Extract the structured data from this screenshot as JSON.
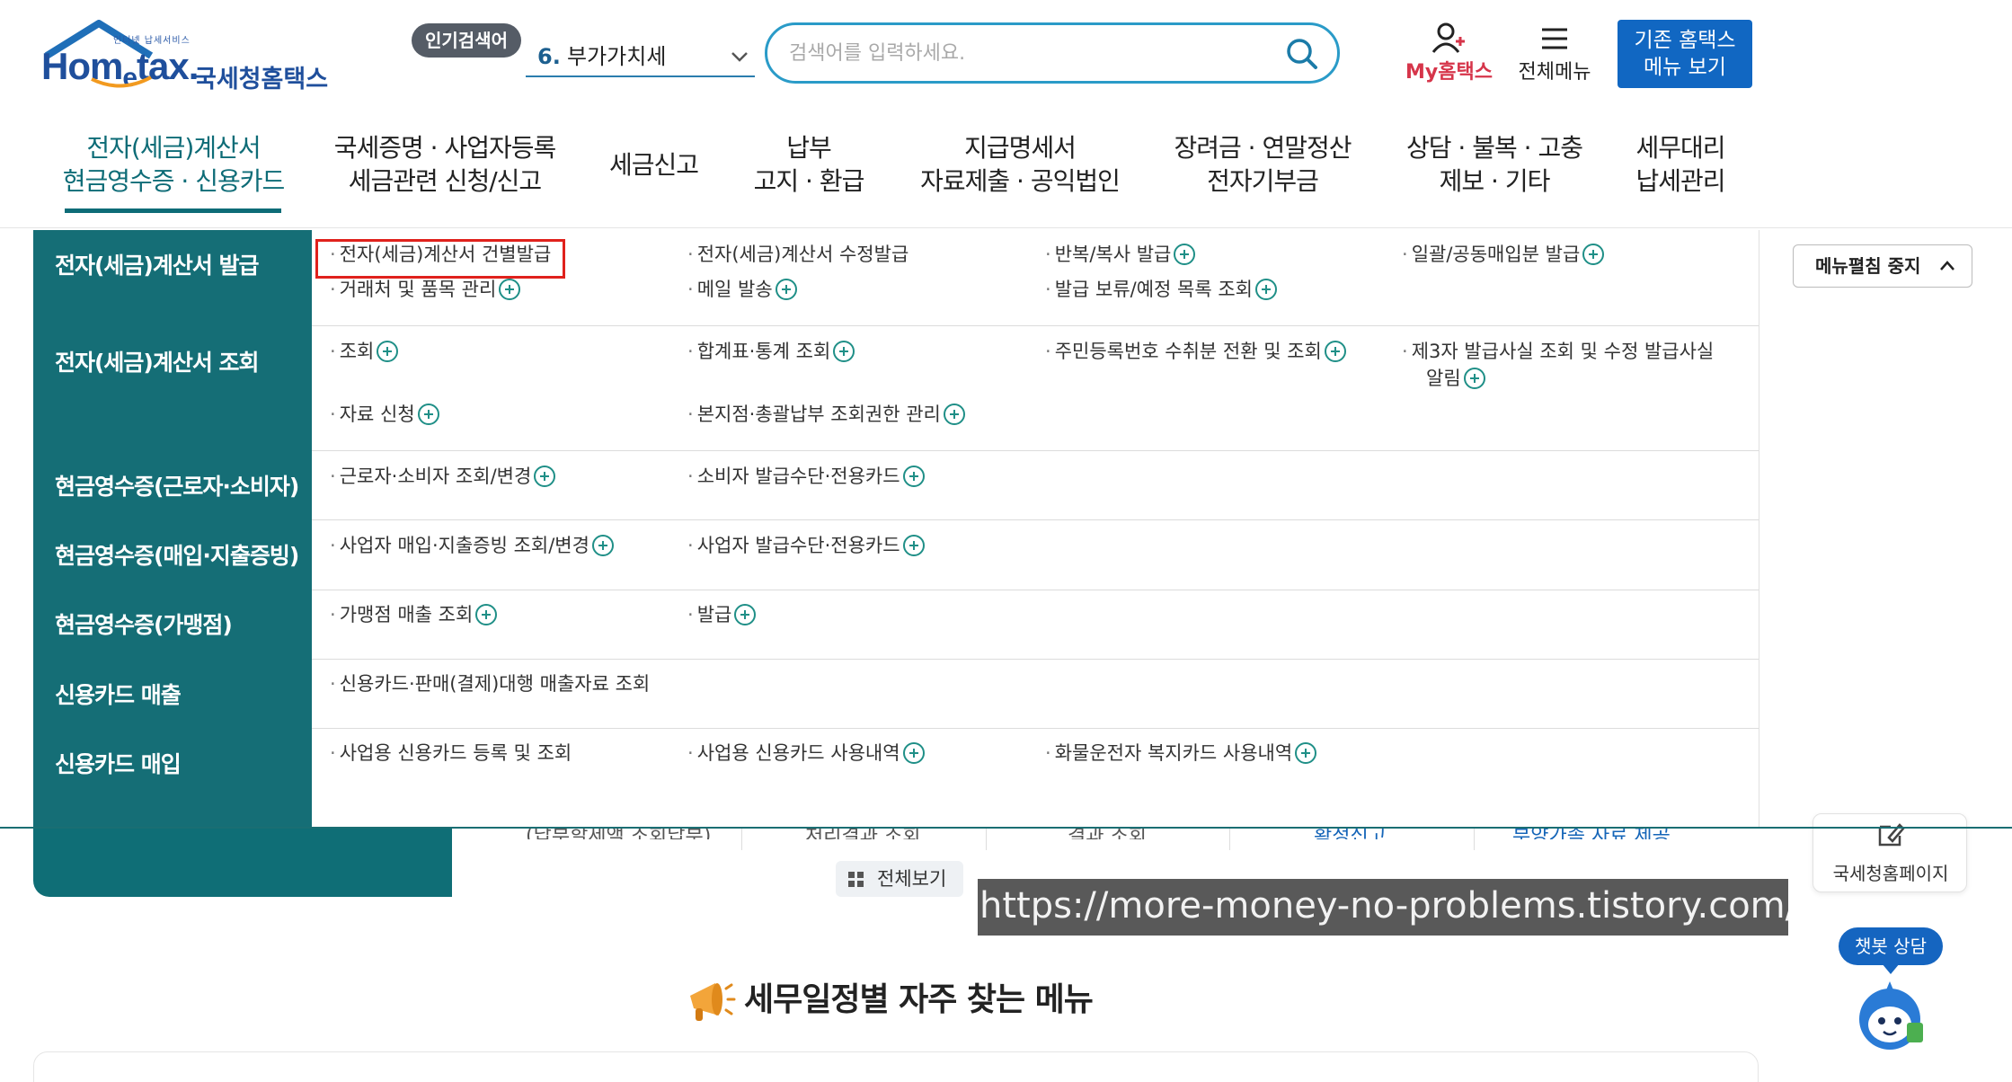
{
  "header": {
    "logo_small": "인터넷 납세서비스",
    "logo_word_1": "Hom",
    "logo_word_e": "e",
    "logo_word_2": "tax.",
    "logo_kr": "국세청홈택스",
    "popular_badge": "인기검색어",
    "popular_rank": "6.",
    "popular_term": "부가가치세",
    "search_placeholder": "검색어를 입력하세요.",
    "my_hometax_prefix": "My",
    "my_hometax_main": "홈택스",
    "all_menu": "전체메뉴",
    "legacy_line1": "기존 홈택스",
    "legacy_line2": "메뉴 보기"
  },
  "nav": [
    {
      "line1": "전자(세금)계산서",
      "line2": "현금영수증 · 신용카드"
    },
    {
      "line1": "국세증명 · 사업자등록",
      "line2": "세금관련 신청/신고"
    },
    {
      "line1": "세금신고",
      "line2": ""
    },
    {
      "line1": "납부",
      "line2": "고지 · 환급"
    },
    {
      "line1": "지급명세서",
      "line2": "자료제출 · 공익법인"
    },
    {
      "line1": "장려금 · 연말정산",
      "line2": "전자기부금"
    },
    {
      "line1": "상담 · 불복 · 고충",
      "line2": "제보 · 기타"
    },
    {
      "line1": "세무대리",
      "line2": "납세관리"
    }
  ],
  "dropdown": {
    "categories": [
      "전자(세금)계산서 발급",
      "전자(세금)계산서 조회",
      "현금영수증(근로자·소비자)",
      "현금영수증(매입·지출증빙)",
      "현금영수증(가맹점)",
      "신용카드 매출",
      "신용카드 매입"
    ],
    "links": {
      "issue_single": "전자(세금)계산서 건별발급",
      "issue_modify": "전자(세금)계산서 수정발급",
      "issue_repeat": "반복/복사 발급",
      "issue_bulk": "일괄/공동매입분 발급",
      "partner_items": "거래처 및 품목 관리",
      "mail_send": "메일 발송",
      "pending_list": "발급 보류/예정 목록 조회",
      "inquiry": "조회",
      "summary_stats": "합계표·통계 조회",
      "rrn_convert": "주민등록번호 수취분 전환 및 조회",
      "third_party_1": "제3자 발급사실 조회 및 수정 발급사실",
      "third_party_2": "알림",
      "data_request": "자료 신청",
      "branch_auth": "본지점·총괄납부 조회권한 관리",
      "worker_inquiry": "근로자·소비자 조회/변경",
      "consumer_means": "소비자 발급수단·전용카드",
      "biz_purchase": "사업자 매입·지출증빙 조회/변경",
      "biz_means": "사업자 발급수단·전용카드",
      "merchant_sales": "가맹점 매출 조회",
      "merchant_issue": "발급",
      "card_sales": "신용카드·판매(결제)대행 매출자료 조회",
      "biz_card_reg": "사업용 신용카드 등록 및 조회",
      "biz_card_usage": "사업용 신용카드 사용내역",
      "freight_card": "화물운전자 복지카드 사용내역"
    },
    "fold_button": "메뉴펼침 중지"
  },
  "under": {
    "texts": [
      "(납부할세액 조회납부)",
      "처리결과 조회",
      "결과 조회",
      "확정신고",
      "부양가족 자료 제공..."
    ],
    "view_all": "전체보기",
    "side_widget": "국세청홈페이지",
    "chatbot": "챗봇 상담",
    "section_title": "세무일정별 자주 찾는 메뉴"
  },
  "watermark": "https://more-money-no-problems.tistory.com/",
  "colors": {
    "teal": "#156e76",
    "accent_blue": "#1167c2",
    "highlight_red": "#e0211c",
    "search_border": "#2a9bc8"
  }
}
